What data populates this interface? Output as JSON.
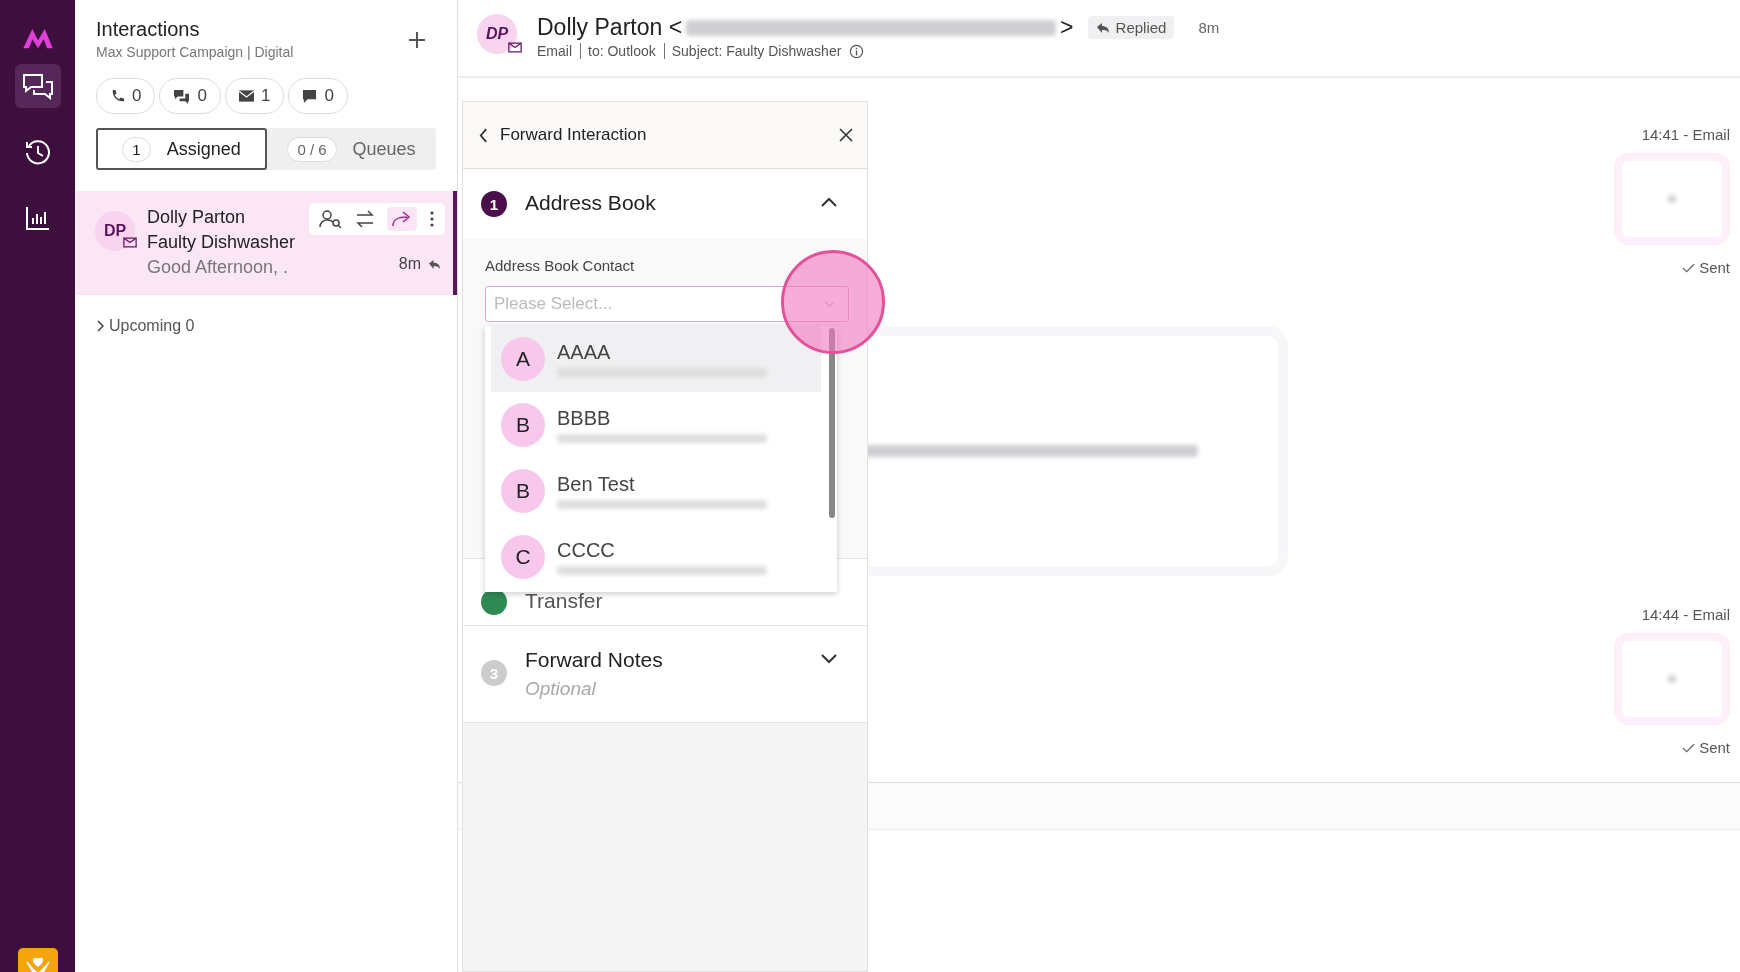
{
  "nav": {
    "items": [
      {
        "kind": "chats",
        "selected": true
      },
      {
        "kind": "history",
        "selected": false
      },
      {
        "kind": "reports",
        "selected": false
      }
    ]
  },
  "interactions": {
    "title": "Interactions",
    "subtitle": "Max Support Campaign | Digital",
    "counters": [
      {
        "kind": "phone",
        "count": "0"
      },
      {
        "kind": "chat",
        "count": "0"
      },
      {
        "kind": "email",
        "count": "1"
      },
      {
        "kind": "message",
        "count": "0"
      }
    ],
    "tabs": [
      {
        "badge": "1",
        "label": "Assigned",
        "selected": true
      },
      {
        "badge": "0 / 6",
        "label": "Queues",
        "selected": false
      }
    ],
    "cards": [
      {
        "initials": "DP",
        "name": "Dolly Parton",
        "subject": "Faulty Dishwasher",
        "preview": "Good Afternoon, .",
        "time": "8m",
        "selected": true
      }
    ],
    "upcoming": "Upcoming 0"
  },
  "header": {
    "initials": "DP",
    "name": "Dolly Parton <",
    "name_end": ">",
    "status": "Replied",
    "age": "8m",
    "meta": [
      "Email",
      "to: Outlook",
      "Subject: Faulty Dishwasher"
    ]
  },
  "forward_panel": {
    "title": "Forward Interaction",
    "sections": [
      {
        "kind": "active",
        "number": "1",
        "title": "Address Book",
        "expanded": true
      },
      {
        "kind": "done",
        "title": "Transfer"
      },
      {
        "kind": "pending",
        "number": "3",
        "title": "Forward Notes",
        "subtitle": "Optional",
        "expanded": false
      }
    ],
    "field_label": "Address Book Contact",
    "placeholder": "Please Select...",
    "options": [
      {
        "letter": "A",
        "name": "AAAA",
        "selected": true
      },
      {
        "letter": "B",
        "name": "BBBB",
        "selected": false
      },
      {
        "letter": "B",
        "name": "Ben Test",
        "selected": false
      },
      {
        "letter": "C",
        "name": "CCCC",
        "selected": false
      }
    ]
  },
  "messages": [
    {
      "kind": "outgoing",
      "stamp": "14:41 - Email",
      "status": "Sent"
    },
    {
      "kind": "incoming"
    },
    {
      "kind": "outgoing",
      "stamp": "14:44 - Email",
      "status": "Sent"
    }
  ]
}
